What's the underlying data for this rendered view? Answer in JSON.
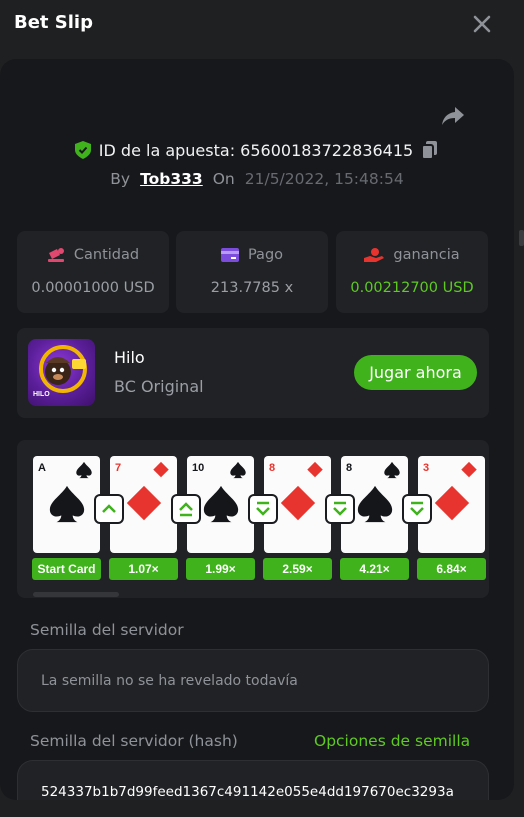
{
  "header": {
    "title": "Bet Slip"
  },
  "bet": {
    "id_label": "ID de la apuesta: 6560018372283641​5",
    "by_label": "By",
    "user": "Tob333",
    "on_label": "On",
    "date": "21/5/2022, 15:48:54"
  },
  "stats": [
    {
      "label": "Cantidad",
      "value": "0.00001000 USD",
      "icon": "coins-icon"
    },
    {
      "label": "Pago",
      "value": "213.7785 x",
      "icon": "card-icon"
    },
    {
      "label": "ganancia",
      "value": "0.00212700 USD",
      "icon": "hand-coin-icon"
    }
  ],
  "game": {
    "name": "Hilo",
    "subtitle": "BC Original",
    "play_label": "Jugar ahora",
    "thumb_text": "HILO"
  },
  "cards": [
    {
      "rank": "A",
      "suit": "spade",
      "mult": "Start Card",
      "arrow": ""
    },
    {
      "rank": "7",
      "suit": "diamond",
      "mult": "1.07×",
      "arrow": "higher"
    },
    {
      "rank": "10",
      "suit": "spade",
      "mult": "1.99×",
      "arrow": "higher-equal"
    },
    {
      "rank": "8",
      "suit": "diamond",
      "mult": "2.59×",
      "arrow": "lower-equal"
    },
    {
      "rank": "8",
      "suit": "spade",
      "mult": "4.21×",
      "arrow": "lower-equal"
    },
    {
      "rank": "3",
      "suit": "diamond",
      "mult": "6.84×",
      "arrow": "lower-equal"
    }
  ],
  "seed": {
    "server_label": "Semilla del servidor",
    "server_value": "La semilla no se ha revelado todavía",
    "hash_label": "Semilla del servidor (hash)",
    "options_label": "Opciones de semilla",
    "hash_value": "524337b1b7d99feed1367c491142e055e4dd197670ec3293a"
  },
  "colors": {
    "green": "#3fb21c",
    "red": "#e8342e",
    "panel": "#17181b",
    "card_bg": "#202225"
  }
}
